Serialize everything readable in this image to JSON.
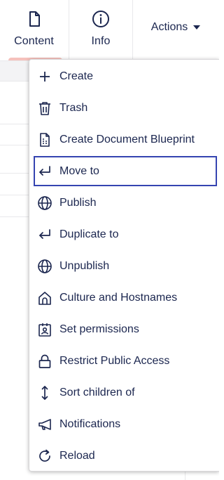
{
  "topbar": {
    "tabs": [
      {
        "label": "Content",
        "icon": "document-icon",
        "active": true
      },
      {
        "label": "Info",
        "icon": "info-icon",
        "active": false
      }
    ],
    "actions_label": "Actions",
    "active_indicator_color": "#f5c1bc"
  },
  "menu": {
    "focus_color": "#3544b1",
    "items": [
      {
        "label": "Create",
        "icon": "plus-icon"
      },
      {
        "label": "Trash",
        "icon": "trash-icon"
      },
      {
        "label": "Create Document Blueprint",
        "icon": "blueprint-icon"
      },
      {
        "label": "Move to",
        "icon": "return-arrow-icon",
        "focused": true
      },
      {
        "label": "Publish",
        "icon": "globe-icon"
      },
      {
        "label": "Duplicate to",
        "icon": "return-arrow-icon"
      },
      {
        "label": "Unpublish",
        "icon": "globe-icon"
      },
      {
        "label": "Culture and Hostnames",
        "icon": "home-icon"
      },
      {
        "label": "Set permissions",
        "icon": "id-badge-icon"
      },
      {
        "label": "Restrict Public Access",
        "icon": "lock-icon"
      },
      {
        "label": "Sort children of",
        "icon": "vertical-arrows-icon"
      },
      {
        "label": "Notifications",
        "icon": "megaphone-icon"
      },
      {
        "label": "Reload",
        "icon": "reload-icon"
      }
    ]
  }
}
